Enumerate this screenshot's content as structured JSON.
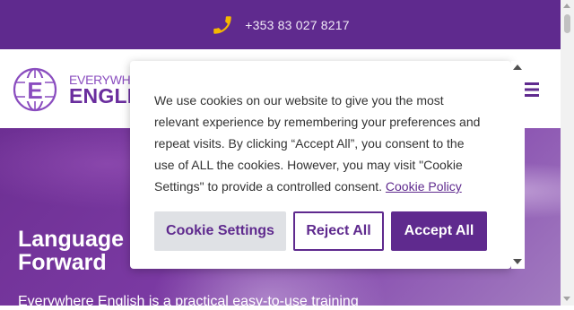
{
  "topbar": {
    "phone": "+353 83 027 8217",
    "icon": "phone-icon"
  },
  "header": {
    "logo_line1": "EVERYWHERE",
    "logo_line2": "ENGLISH",
    "logo_letter": "E",
    "menu_icon": "hamburger-menu-icon"
  },
  "hero": {
    "title_line1": "Language",
    "title_line2": "Forward",
    "subtitle": "Everywhere English is a practical easy-to-use training"
  },
  "cookie": {
    "text": "We use cookies on our website to give you the most relevant experience by remembering your preferences and repeat visits. By clicking “Accept All”, you consent to the use of ALL the cookies. However, you may visit \"Cookie Settings\" to provide a controlled consent.",
    "policy_link": "Cookie Policy",
    "settings_label": "Cookie Settings",
    "reject_label": "Reject All",
    "accept_label": "Accept All"
  },
  "colors": {
    "brand": "#5f2a8e",
    "accent": "#f5b800",
    "settings_bg": "#dfe1e5"
  }
}
